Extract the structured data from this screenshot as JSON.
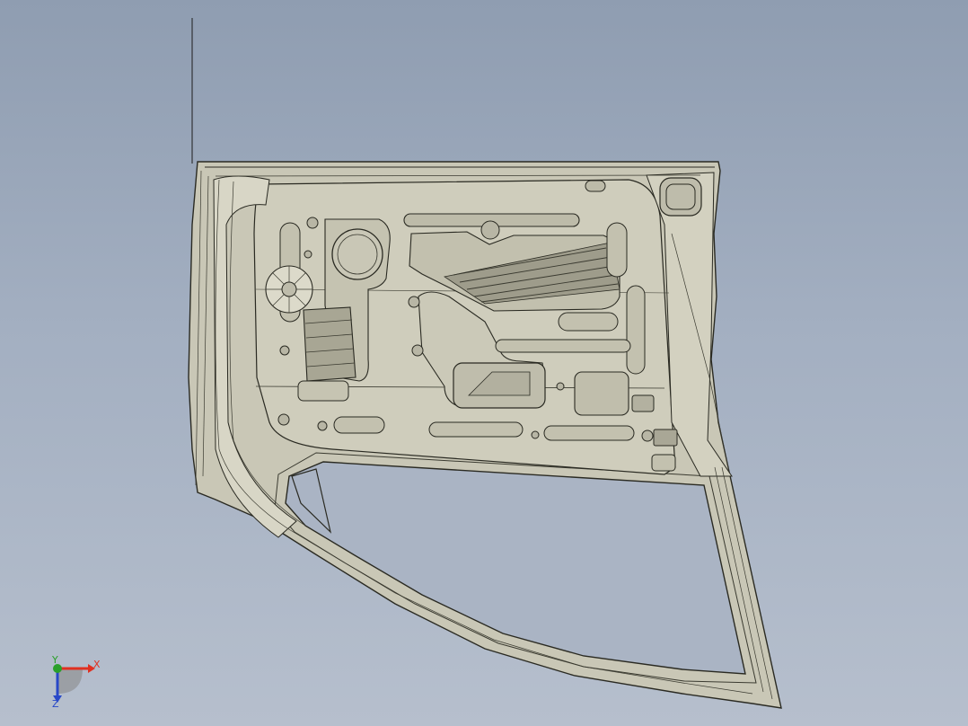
{
  "viewport": {
    "background_top": "#8f9db1",
    "background_bottom": "#b6bfcd",
    "model": {
      "name": "door-inner-panel",
      "fill_color": "#c9c7b6",
      "edge_color": "#2a2a22",
      "window_color": "#aab4c4"
    }
  },
  "triad": {
    "x_label": "X",
    "y_label": "Y",
    "z_label": "Z",
    "x_color": "#e03020",
    "y_color": "#2aa02a",
    "z_color": "#2848c8"
  }
}
